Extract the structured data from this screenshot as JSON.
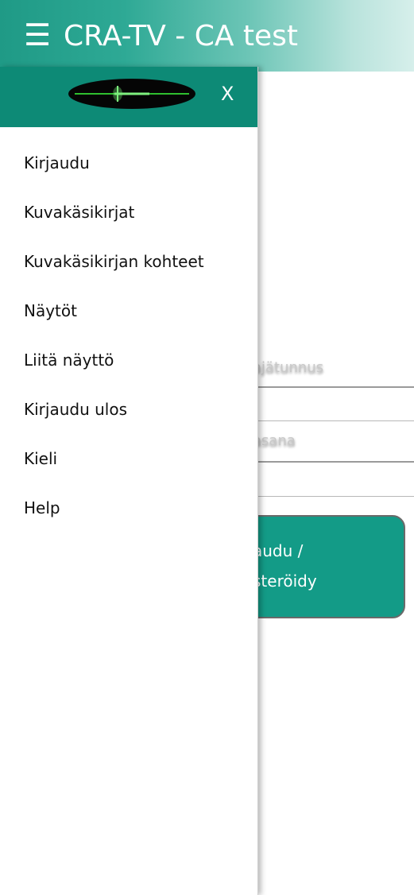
{
  "appbar": {
    "menu_icon": "☰",
    "title": "CRA-TV - CA test"
  },
  "background_form": {
    "username_label_partial": "ajätunnus",
    "password_label_partial": "asana",
    "button_line1_partial": "audu /",
    "button_line2_partial": "steröidy"
  },
  "drawer": {
    "close_label": "X",
    "menu_items": [
      "Kirjaudu",
      "Kuvakäsikirjat",
      "Kuvakäsikirjan kohteet",
      "Näytöt",
      "Liitä näyttö",
      "Kirjaudu ulos",
      "Kieli",
      "Help"
    ]
  },
  "colors": {
    "primary": "#139b87",
    "drawer_header": "#0d8a76",
    "appbar_gradient_start": "#1f9a86",
    "appbar_gradient_end": "#d6efeb"
  }
}
